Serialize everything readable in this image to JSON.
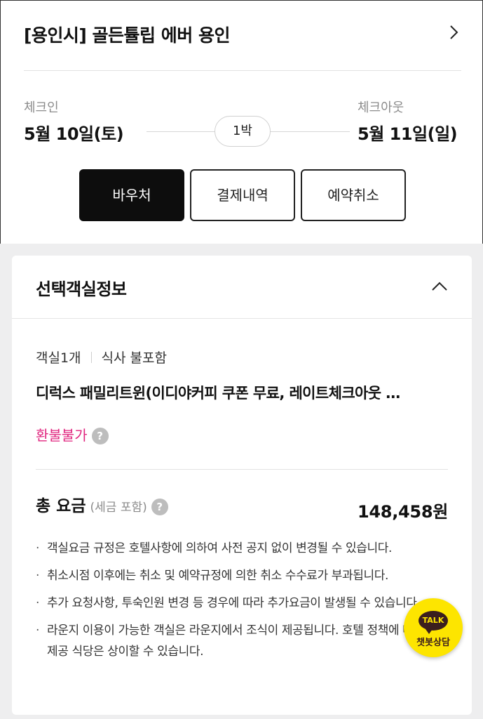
{
  "header": {
    "hotel_name": "[용인시] 골든튤립 에버 용인",
    "chevron_icon": "chevron-right-icon"
  },
  "stay": {
    "checkin_label": "체크인",
    "checkin_date": "5월 10일(토)",
    "nights": "1박",
    "checkout_label": "체크아웃",
    "checkout_date": "5월 11일(일)"
  },
  "actions": {
    "voucher": "바우처",
    "payment_history": "결제내역",
    "cancel_reservation": "예약취소"
  },
  "room_info": {
    "section_title": "선택객실정보",
    "room_count": "객실1개",
    "meal": "식사 불포함",
    "room_name": "디럭스 패밀리트윈(이디야커피 쿠폰 무료, 레이트체크아웃 …",
    "refund_policy": "환불불가",
    "help_icon": "?",
    "total_label": "총 요금",
    "tax_note": "(세금 포함)",
    "total_amount": "148,458원",
    "notes": [
      "객실요금 규정은 호텔사항에 의하여 사전 공지 없이 변경될 수 있습니다.",
      "취소시점 이후에는 취소 및 예약규정에 의한 취소 수수료가 부과됩니다.",
      "추가 요청사항, 투숙인원 변경 등 경우에 따라 추가요금이 발생될 수 있습니다.",
      "라운지 이용이 가능한 객실은 라운지에서 조식이 제공됩니다. 호텔 정책에 따라 조식 제공 식당은 상이할 수 있습니다."
    ]
  },
  "chatbot": {
    "talk": "TALK",
    "label": "챗봇상담"
  },
  "colors": {
    "refund_accent": "#e0267f",
    "primary_button": "#0d0d0d",
    "chat_bg": "#fde500"
  }
}
